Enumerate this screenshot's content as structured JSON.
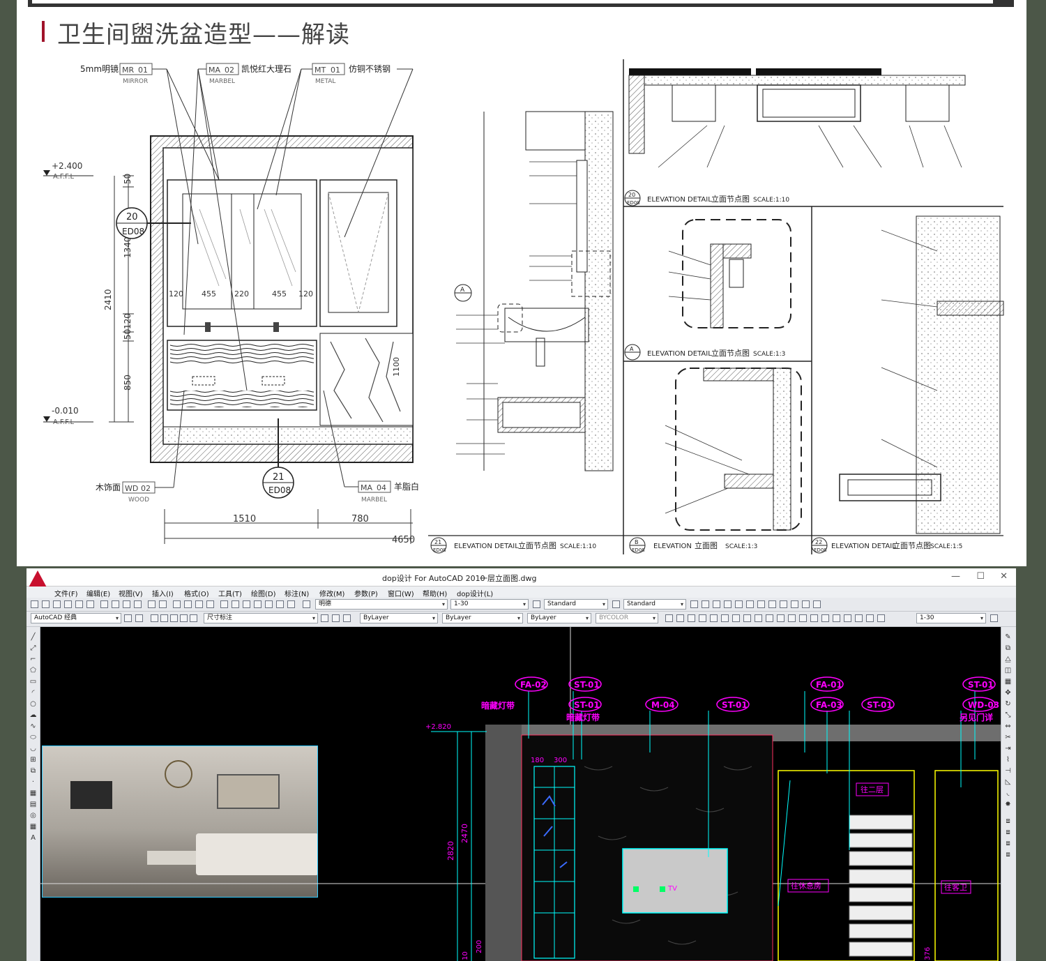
{
  "colors": {
    "accent": "#a0132a",
    "cad_magenta": "#ff00ff",
    "cad_cyan": "#00ffff",
    "cad_yellow": "#ffff00"
  },
  "page": {
    "title": "卫生间盥洗盆造型——解读"
  },
  "elevation": {
    "top_level": "+2.400",
    "bottom_level": "-0.010",
    "afl": "A.F.F.L",
    "tags": [
      {
        "label": "5mm明镜",
        "code": "MR",
        "num": "01",
        "sub": "MIRROR"
      },
      {
        "label": "凯悦红大理石",
        "code": "MA",
        "num": "02",
        "sub": "MARBEL"
      },
      {
        "label": "仿铜不锈钢",
        "code": "MT",
        "num": "01",
        "sub": "METAL"
      },
      {
        "label": "木饰面",
        "code": "WD",
        "num": "02",
        "sub": "WOOD"
      },
      {
        "label": "羊脂白",
        "code": "MA",
        "num": "04",
        "sub": "MARBEL"
      }
    ],
    "vdims": [
      "50",
      "1340",
      "2410",
      "120",
      "50",
      "850"
    ],
    "hdims": [
      "1510",
      "780",
      "4650"
    ],
    "inner_dims": [
      "120",
      "455",
      "220",
      "455",
      "120",
      "1100"
    ],
    "callout_top": {
      "num": "20",
      "code": "ED08"
    },
    "callout_bottom": {
      "num": "21",
      "code": "ED08"
    }
  },
  "details": {
    "titles": [
      {
        "num": "20",
        "code": "ED08",
        "en": "ELEVATION DETAIL",
        "cn": "立面节点图",
        "scale": "SCALE:1:10"
      },
      {
        "num": "A",
        "code": "",
        "en": "ELEVATION DETAIL",
        "cn": "立面节点图",
        "scale": "SCALE:1:3"
      },
      {
        "num": "21",
        "code": "ED08",
        "en": "ELEVATION DETAIL",
        "cn": "立面节点图",
        "scale": "SCALE:1:10"
      },
      {
        "num": "B",
        "code": "ED08",
        "en": "ELEVATION",
        "cn": "立面图",
        "scale": "SCALE:1:3"
      },
      {
        "num": "22",
        "code": "ED08",
        "en": "ELEVATION DETAIL",
        "cn": "立面节点图",
        "scale": "SCALE:1:5"
      }
    ],
    "callout_a": "A"
  },
  "cad": {
    "title": "dop设计 For AutoCAD 2010",
    "document": "一层立面图.dwg",
    "menus": [
      "文件(F)",
      "编辑(E)",
      "视图(V)",
      "插入(I)",
      "格式(O)",
      "工具(T)",
      "绘图(D)",
      "标注(N)",
      "修改(M)",
      "参数(P)",
      "窗口(W)",
      "帮助(H)",
      "dop设计(L)"
    ],
    "workspace": "AutoCAD 经典",
    "dim_style": "尺寸标注",
    "text_style": "明德",
    "scale": "1-30",
    "style1": "Standard",
    "style2": "Standard",
    "layer": "ByLayer",
    "linetype": "ByLayer",
    "lineweight": "ByLayer",
    "plotstyle": "BYCOLOR",
    "scale2": "1-30"
  },
  "drawing": {
    "tags": [
      "FA-02",
      "ST-01",
      "ST-01",
      "M-04",
      "ST-01",
      "FA-01",
      "FA-03",
      "ST-01",
      "ST-01",
      "WD-03"
    ],
    "notes": [
      "暗藏灯带",
      "暗藏灯带",
      "另见门详",
      "往二层",
      "往休息房",
      "往客卫"
    ],
    "level": "+2.820",
    "dims": [
      "2820",
      "2470",
      "180",
      "300",
      "200",
      "10",
      "376"
    ],
    "tv": "TV"
  }
}
